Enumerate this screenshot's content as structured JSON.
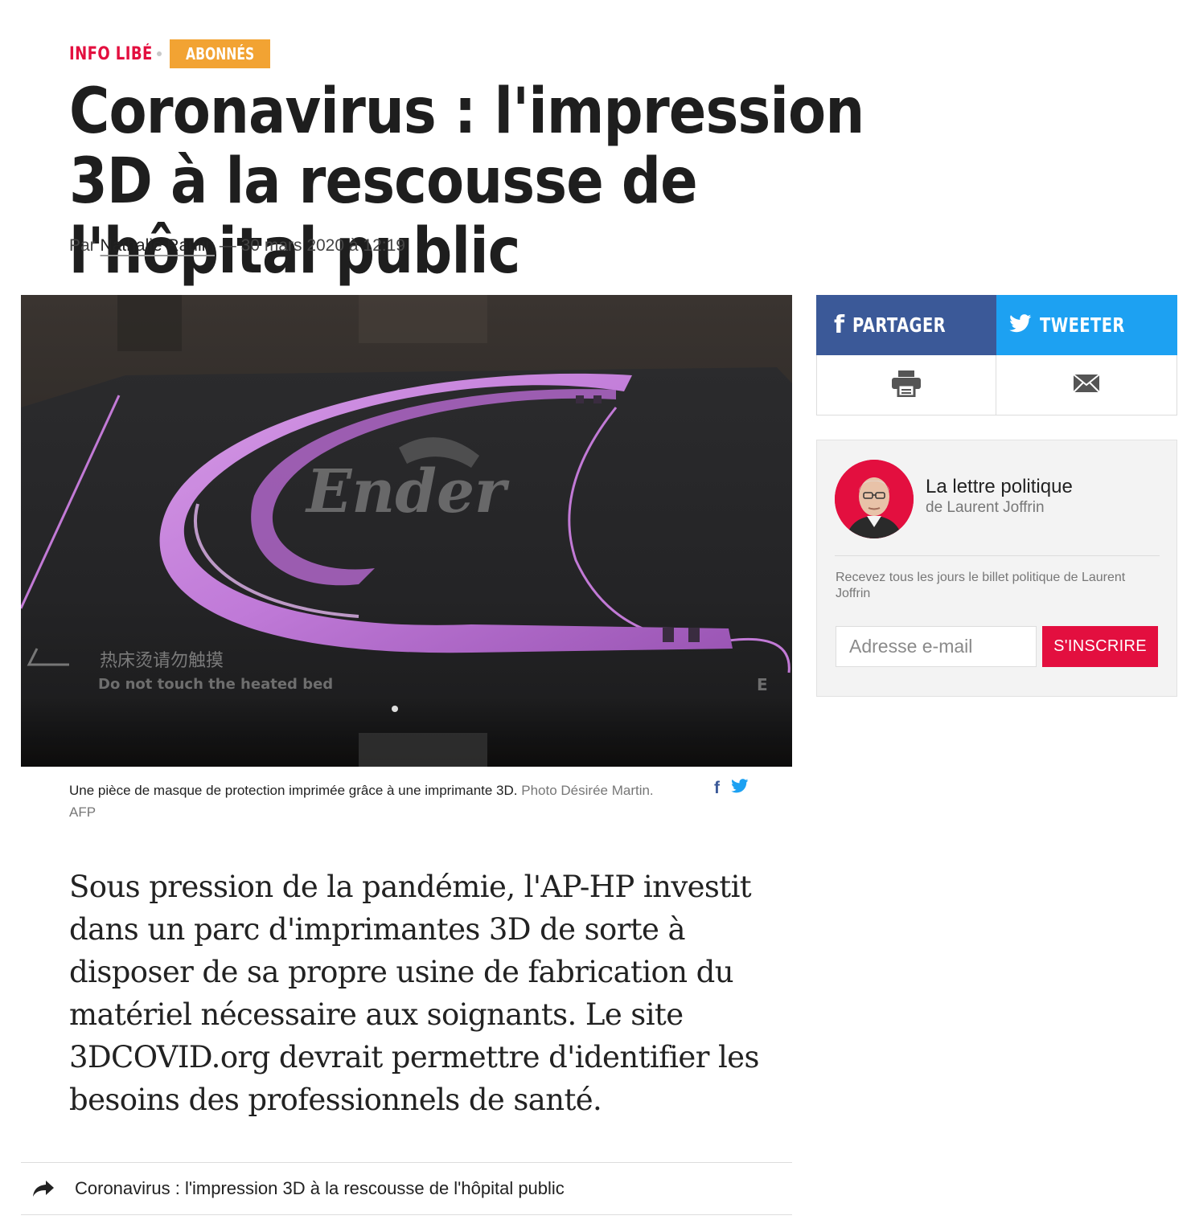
{
  "kicker": {
    "section": "INFO LIBÉ",
    "badge": "ABONNÉS"
  },
  "article": {
    "title": "Coronavirus : l'impression 3D à la rescousse de l'hôpital public",
    "byline": {
      "prefix": "Par",
      "author": "Nathalie Raulin",
      "date": "— 30 mars 2020 à 12:19"
    },
    "photo": {
      "printed_text": {
        "brand": "Ender",
        "warning_cn": "热床烫请勿触摸",
        "warning_en": "Do not touch the heated bed",
        "edge_letter": "E"
      },
      "caption": "Une pièce de masque de protection imprimée grâce à une imprimante 3D.",
      "credit": "Photo Désirée Martin. AFP"
    },
    "lede": "Sous pression de la pandémie, l'AP-HP investit dans un parc d'imprimantes 3D de sorte à disposer de sa propre usine de fabrication du matériel nécessaire aux soignants. Le site 3DCOVID.org devrait permettre d'identifier les besoins des professionnels de santé.",
    "related": "Coronavirus : l'impression 3D à la rescousse de l'hôpital public"
  },
  "share": {
    "facebook_label": "PARTAGER",
    "twitter_label": "TWEETER",
    "colors": {
      "facebook": "#3b5998",
      "twitter": "#1da1f2"
    }
  },
  "newsletter": {
    "title": "La lettre politique",
    "subtitle": "de Laurent Joffrin",
    "description": "Recevez tous les jours le billet politique de Laurent Joffrin",
    "email_placeholder": "Adresse e-mail",
    "email_value": "",
    "button_label": "S'INSCRIRE"
  },
  "colors": {
    "accent": "#e30f3f",
    "badge": "#f2a333",
    "mask": "#c27ad6"
  }
}
